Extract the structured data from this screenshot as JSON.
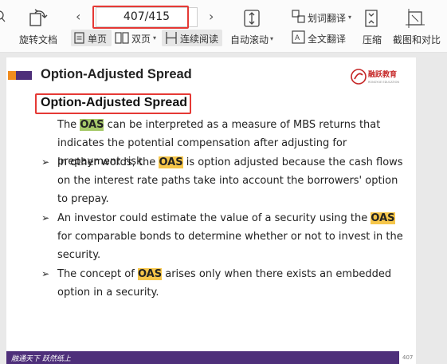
{
  "toolbar": {
    "rotate_label": "旋转文档",
    "page_indicator": "407/415",
    "single_page_label": "单页",
    "double_page_label": "双页",
    "continuous_label": "连续阅读",
    "auto_scroll_label": "自动滚动",
    "word_translate_label": "划词翻译",
    "full_translate_label": "全文翻译",
    "compress_label": "压缩",
    "screenshot_compare_label": "截图和对比"
  },
  "slide": {
    "title": "Option-Adjusted Spread",
    "subtitle": "Option-Adjusted Spread",
    "logo_text": "融跃教育",
    "logo_sub": "RONGYUE EDUCATION",
    "intro": {
      "pre": "The ",
      "term": "OAS",
      "post": " can be interpreted as a measure of MBS returns that indicates the potential compensation after adjusting for prepayment risk."
    },
    "bullets": [
      {
        "pre": "In other words, the ",
        "term": "OAS",
        "post": " is option adjusted because the cash flows on the interest rate paths take into account the borrowers' option to prepay."
      },
      {
        "pre": "An investor could estimate the value of a security using the ",
        "term": "OAS",
        "post": " for comparable bonds to determine whether or not to invest in the security."
      },
      {
        "pre": "The concept of ",
        "term": "OAS",
        "post": " arises only  when there exists an embedded  option in a security."
      }
    ],
    "footer_slogan": "融通天下 跃然纸上",
    "page_number": "407"
  },
  "colors": {
    "accent_purple": "#4e2f7a",
    "accent_orange": "#f08c1e",
    "highlight_yellow": "#f6c64a",
    "highlight_green": "#a7c96b",
    "annotation_red": "#e53935"
  }
}
